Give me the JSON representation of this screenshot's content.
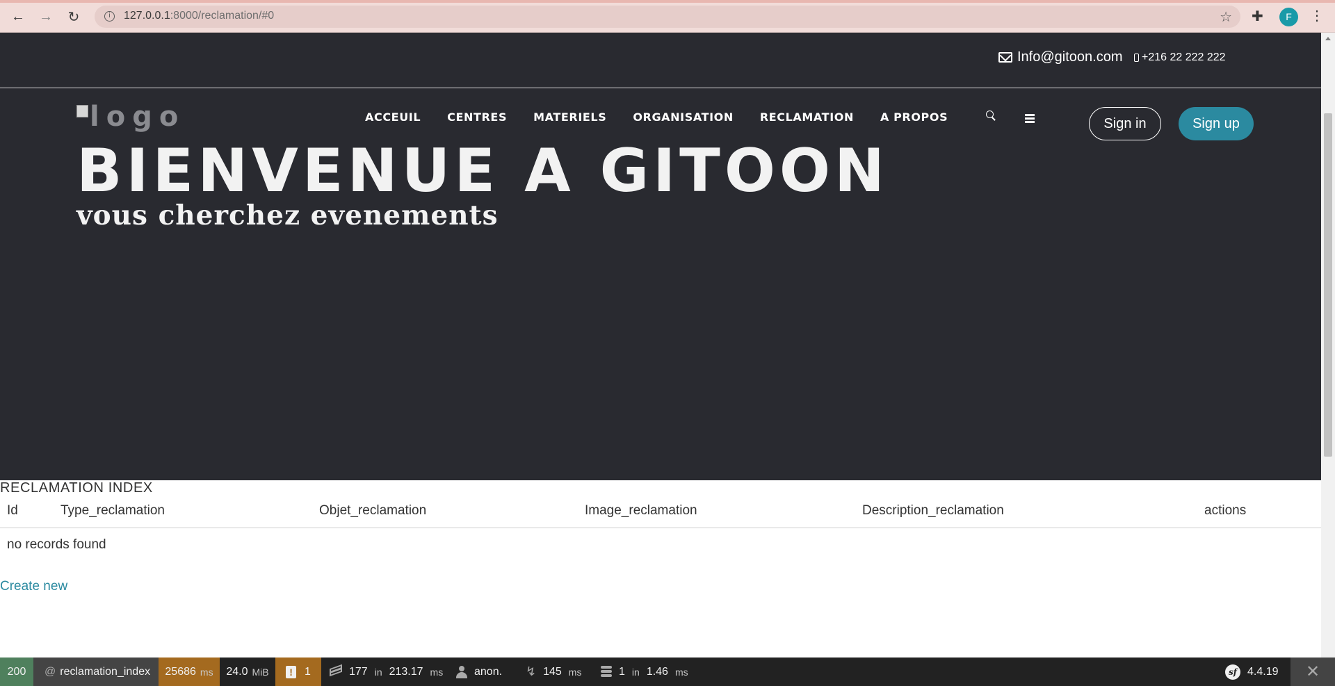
{
  "browser": {
    "url_host": "127.0.0.1",
    "url_path": ":8000/reclamation/#0",
    "profile_initial": "F"
  },
  "topbar": {
    "email": "Info@gitoon.com",
    "phone": "+216 22 222 222"
  },
  "header": {
    "logo_alt": "logo",
    "nav": [
      "ACCEUIL",
      "CENTRES",
      "MATERIELS",
      "ORGANISATION",
      "RECLAMATION",
      "A PROPOS"
    ],
    "signin": "Sign in",
    "signup": "Sign up",
    "accent_color": "#2b8aa0"
  },
  "hero": {
    "title": "BIENVENUE A GITOON",
    "subtitle": "vous cherchez evenements"
  },
  "content": {
    "index_title": "RECLAMATION INDEX",
    "columns": [
      "Id",
      "Type_reclamation",
      "Objet_reclamation",
      "Image_reclamation",
      "Description_reclamation",
      "actions"
    ],
    "empty_message": "no records found",
    "create_link": "Create new"
  },
  "debug_toolbar": {
    "status": "200",
    "route_prefix": "@",
    "route": "reclamation_index",
    "time": "25686",
    "time_unit": "ms",
    "memory": "24.0",
    "memory_unit": "MiB",
    "warnings": "1",
    "twig_count": "177",
    "twig_in": "in",
    "twig_time": "213.17",
    "twig_unit": "ms",
    "user": "anon.",
    "perf_time": "145",
    "perf_unit": "ms",
    "db_count": "1",
    "db_in": "in",
    "db_time": "1.46",
    "db_unit": "ms",
    "version": "4.4.19",
    "sf_logo": "sf"
  }
}
